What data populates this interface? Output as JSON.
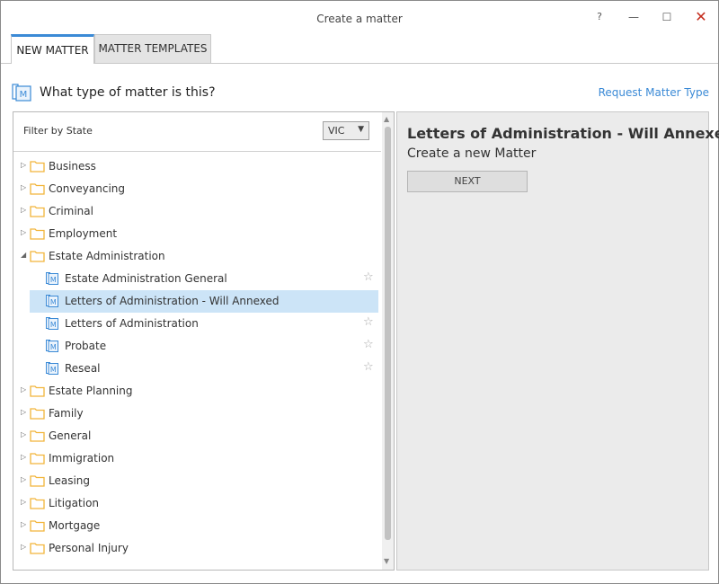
{
  "window": {
    "title": "Create a matter",
    "help": "?",
    "minimize": "—",
    "maximize": "☐",
    "close": "✕"
  },
  "tabs": [
    {
      "label": "NEW MATTER",
      "active": true
    },
    {
      "label": "MATTER TEMPLATES",
      "active": false
    }
  ],
  "question": "What type of matter is this?",
  "request_link": "Request Matter Type",
  "filter": {
    "label": "Filter by State",
    "value": "VIC"
  },
  "tree": [
    {
      "label": "Business",
      "type": "folder",
      "expanded": false
    },
    {
      "label": "Conveyancing",
      "type": "folder",
      "expanded": false
    },
    {
      "label": "Criminal",
      "type": "folder",
      "expanded": false
    },
    {
      "label": "Employment",
      "type": "folder",
      "expanded": false
    },
    {
      "label": "Estate Administration",
      "type": "folder",
      "expanded": true
    },
    {
      "label": "Estate Administration General",
      "type": "matter",
      "selected": false
    },
    {
      "label": "Letters of Administration - Will Annexed",
      "type": "matter",
      "selected": true
    },
    {
      "label": "Letters of Administration",
      "type": "matter",
      "selected": false
    },
    {
      "label": "Probate",
      "type": "matter",
      "selected": false
    },
    {
      "label": "Reseal",
      "type": "matter",
      "selected": false
    },
    {
      "label": "Estate Planning",
      "type": "folder",
      "expanded": false
    },
    {
      "label": "Family",
      "type": "folder",
      "expanded": false
    },
    {
      "label": "General",
      "type": "folder",
      "expanded": false
    },
    {
      "label": "Immigration",
      "type": "folder",
      "expanded": false
    },
    {
      "label": "Leasing",
      "type": "folder",
      "expanded": false
    },
    {
      "label": "Litigation",
      "type": "folder",
      "expanded": false
    },
    {
      "label": "Mortgage",
      "type": "folder",
      "expanded": false
    },
    {
      "label": "Personal Injury",
      "type": "folder",
      "expanded": false
    }
  ],
  "detail": {
    "title": "Letters of Administration - Will Annexed",
    "subtitle": "Create a new Matter",
    "next_label": "NEXT"
  },
  "colors": {
    "accent": "#3b8ad6",
    "selection": "#cce4f7",
    "folder": "#f2b53a",
    "close": "#c42b1c"
  }
}
